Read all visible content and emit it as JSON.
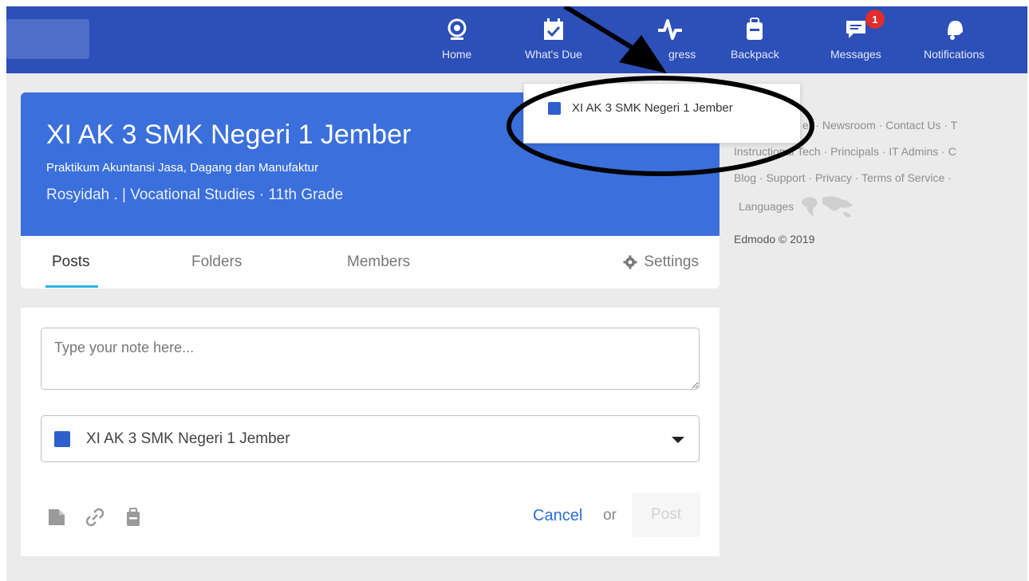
{
  "nav": {
    "items": [
      {
        "label": "Home",
        "icon": "home-icon"
      },
      {
        "label": "What's Due",
        "icon": "calendar-check-icon"
      },
      {
        "label": "gress",
        "icon": "progress-pulse-icon"
      },
      {
        "label": "Backpack",
        "icon": "backpack-icon"
      },
      {
        "label": "Messages",
        "icon": "chat-icon",
        "badge": "1"
      },
      {
        "label": "Notifications",
        "icon": "bell-icon"
      }
    ]
  },
  "dropdown": {
    "item_label": "XI AK 3 SMK Negeri 1 Jember"
  },
  "group": {
    "title": "XI AK 3 SMK Negeri 1 Jember",
    "subtitle": "Praktikum Akuntansi Jasa, Dagang dan Manufaktur",
    "meta": "Rosyidah . | Vocational Studies  · 11th Grade"
  },
  "tabs": {
    "posts": "Posts",
    "folders": "Folders",
    "members": "Members",
    "settings": "Settings"
  },
  "composer": {
    "placeholder": "Type your note here...",
    "selected_group": "XI AK 3 SMK Negeri 1 Jember",
    "cancel": "Cancel",
    "or": "or",
    "post": "Post"
  },
  "footer_links": {
    "row1": "er · Newsroom · Contact Us · T",
    "row2": "Instructional Tech · Principals · IT Admins · C",
    "row3": "Blog · Support · Privacy · Terms of Service ·",
    "languages": "Languages",
    "copyright": "Edmodo © 2019"
  },
  "colors": {
    "nav": "#2c4fb8",
    "group_header": "#3b6fdc",
    "accent_link": "#2b6ed2",
    "tab_underline": "#2ab5e6",
    "badge": "#e02d2d"
  }
}
